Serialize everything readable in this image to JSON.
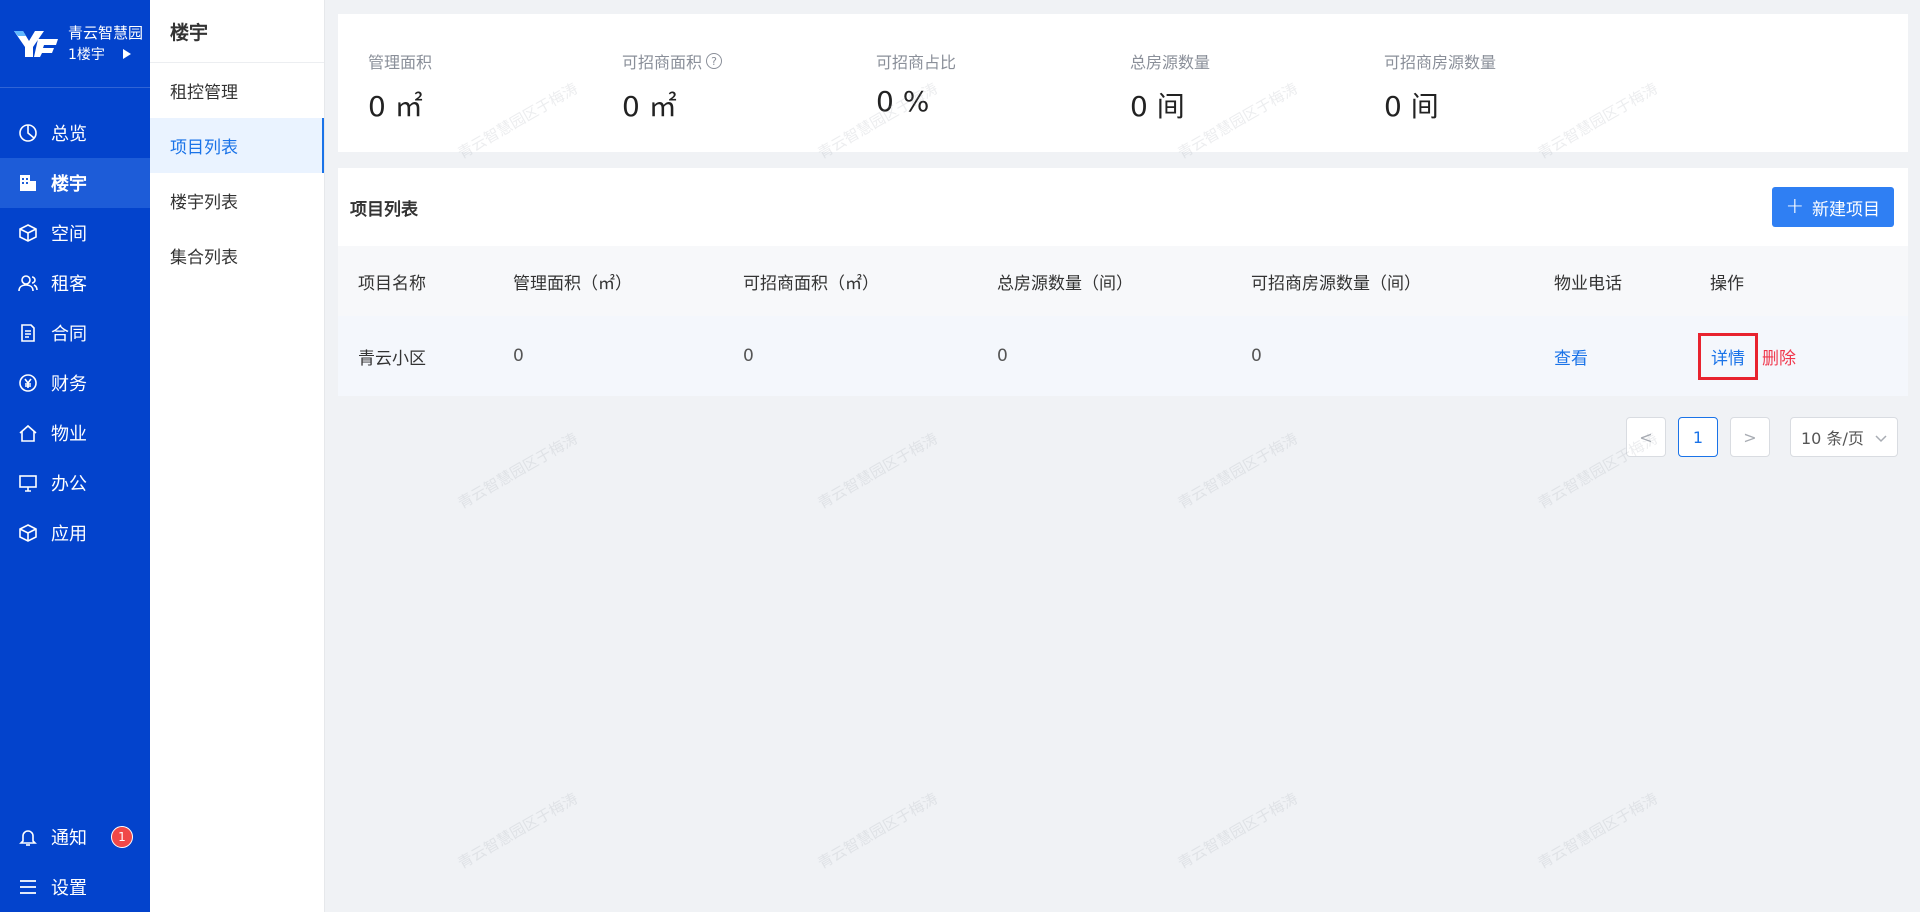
{
  "brand": {
    "name": "青云智慧园区",
    "building": "1楼宇"
  },
  "nav": {
    "items": [
      {
        "label": "总览",
        "icon": "pie-chart-icon"
      },
      {
        "label": "楼宇",
        "icon": "building-icon",
        "active": true
      },
      {
        "label": "空间",
        "icon": "cube-icon"
      },
      {
        "label": "租客",
        "icon": "users-icon"
      },
      {
        "label": "合同",
        "icon": "document-icon"
      },
      {
        "label": "财务",
        "icon": "yen-icon"
      },
      {
        "label": "物业",
        "icon": "home-icon"
      },
      {
        "label": "办公",
        "icon": "monitor-icon"
      },
      {
        "label": "应用",
        "icon": "box-icon"
      }
    ],
    "bottom": {
      "notify_label": "通知",
      "notify_badge": "1",
      "settings_label": "设置"
    }
  },
  "subnav": {
    "title": "楼宇",
    "items": [
      {
        "label": "租控管理"
      },
      {
        "label": "项目列表",
        "active": true
      },
      {
        "label": "楼宇列表"
      },
      {
        "label": "集合列表"
      }
    ]
  },
  "stats": [
    {
      "label": "管理面积",
      "value": "0 ㎡"
    },
    {
      "label": "可招商面积",
      "value": "0 ㎡",
      "help": "?"
    },
    {
      "label": "可招商占比",
      "value": "0 %"
    },
    {
      "label": "总房源数量",
      "value": "0 间"
    },
    {
      "label": "可招商房源数量",
      "value": "0 间"
    }
  ],
  "list": {
    "title": "项目列表",
    "new_button": "新建项目",
    "columns": [
      "项目名称",
      "管理面积（㎡）",
      "可招商面积（㎡）",
      "总房源数量（间）",
      "可招商房源数量（间）",
      "物业电话",
      "操作"
    ],
    "rows": [
      {
        "name": "青云小区",
        "area": "0",
        "rentable_area": "0",
        "rooms": "0",
        "rentable_rooms": "0",
        "phone_link": "查看",
        "detail": "详情",
        "delete": "删除"
      }
    ]
  },
  "pagination": {
    "prev": "<",
    "current": "1",
    "next": ">",
    "page_size": "10 条/页"
  },
  "watermark": "青云智慧园区于梅涛",
  "colors": {
    "nav_bg": "#0343cc",
    "primary": "#2f7ff3",
    "danger": "#f0384d",
    "highlight_box": "#e8232f"
  }
}
